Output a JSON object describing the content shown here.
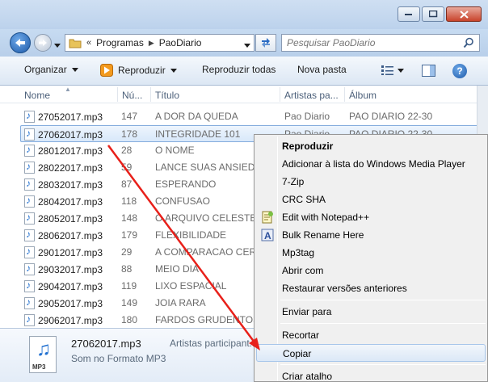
{
  "window": {
    "address": {
      "segments": [
        "Programas",
        "PaoDiario"
      ],
      "overflow": "«"
    },
    "search": {
      "placeholder": "Pesquisar PaoDiario"
    }
  },
  "toolbar": {
    "organize": "Organizar",
    "play": "Reproduzir",
    "play_all": "Reproduzir todas",
    "new_folder": "Nova pasta"
  },
  "columns": {
    "name": "Nome",
    "number": "Nú...",
    "title": "Título",
    "artists": "Artistas pa...",
    "album": "Álbum"
  },
  "files": [
    {
      "name": "27052017.mp3",
      "number": "147",
      "title": "A DOR DA QUEDA",
      "artist": "Pao Diario",
      "album": "PAO DIARIO 22-30"
    },
    {
      "name": "27062017.mp3",
      "number": "178",
      "title": "INTEGRIDADE 101",
      "artist": "Pao Diario",
      "album": "PAO DIARIO 22-30"
    },
    {
      "name": "28012017.mp3",
      "number": "28",
      "title": "O NOME",
      "artist": "",
      "album": ""
    },
    {
      "name": "28022017.mp3",
      "number": "59",
      "title": "LANCE SUAS ANSIEDA",
      "artist": "",
      "album": ""
    },
    {
      "name": "28032017.mp3",
      "number": "87",
      "title": "ESPERANDO",
      "artist": "",
      "album": ""
    },
    {
      "name": "28042017.mp3",
      "number": "118",
      "title": "CONFUSAO",
      "artist": "",
      "album": ""
    },
    {
      "name": "28052017.mp3",
      "number": "148",
      "title": "O ARQUIVO CELESTE",
      "artist": "",
      "album": ""
    },
    {
      "name": "28062017.mp3",
      "number": "179",
      "title": "FLEXIBILIDADE",
      "artist": "",
      "album": ""
    },
    {
      "name": "29012017.mp3",
      "number": "29",
      "title": "A COMPARACAO CERT",
      "artist": "",
      "album": ""
    },
    {
      "name": "29032017.mp3",
      "number": "88",
      "title": "MEIO DIA",
      "artist": "",
      "album": ""
    },
    {
      "name": "29042017.mp3",
      "number": "119",
      "title": "LIXO ESPACIAL",
      "artist": "",
      "album": ""
    },
    {
      "name": "29052017.mp3",
      "number": "149",
      "title": "JOIA RARA",
      "artist": "",
      "album": ""
    },
    {
      "name": "29062017.mp3",
      "number": "180",
      "title": "FARDOS GRUDENTOS",
      "artist": "",
      "album": ""
    }
  ],
  "details": {
    "filename": "27062017.mp3",
    "filetype": "Som no Formato MP3",
    "artists_label": "Artistas participant...",
    "icon_label": "MP3"
  },
  "context_menu": {
    "items": [
      {
        "label": "Reproduzir",
        "bold": true,
        "icon": ""
      },
      {
        "label": "Adicionar à lista do Windows Media Player",
        "icon": ""
      },
      {
        "label": "7-Zip",
        "icon": ""
      },
      {
        "label": "CRC SHA",
        "icon": ""
      },
      {
        "label": "Edit with Notepad++",
        "icon": "notepad-plus-plus-icon"
      },
      {
        "label": "Bulk Rename Here",
        "icon": "bulk-rename-icon"
      },
      {
        "label": "Mp3tag",
        "icon": ""
      },
      {
        "label": "Abrir com",
        "icon": ""
      },
      {
        "label": "Restaurar versões anteriores",
        "icon": ""
      },
      {
        "label": "Enviar para",
        "icon": ""
      },
      {
        "label": "Recortar",
        "icon": ""
      },
      {
        "label": "Copiar",
        "icon": "",
        "highlighted": true
      },
      {
        "label": "Criar atalho",
        "icon": ""
      }
    ]
  },
  "annotation": {
    "arrow_color": "#e8201a"
  },
  "colors": {
    "selection_border": "#84acdd",
    "menu_bg": "#f0f0f0",
    "toolbar_bg": "#dce7f4"
  }
}
